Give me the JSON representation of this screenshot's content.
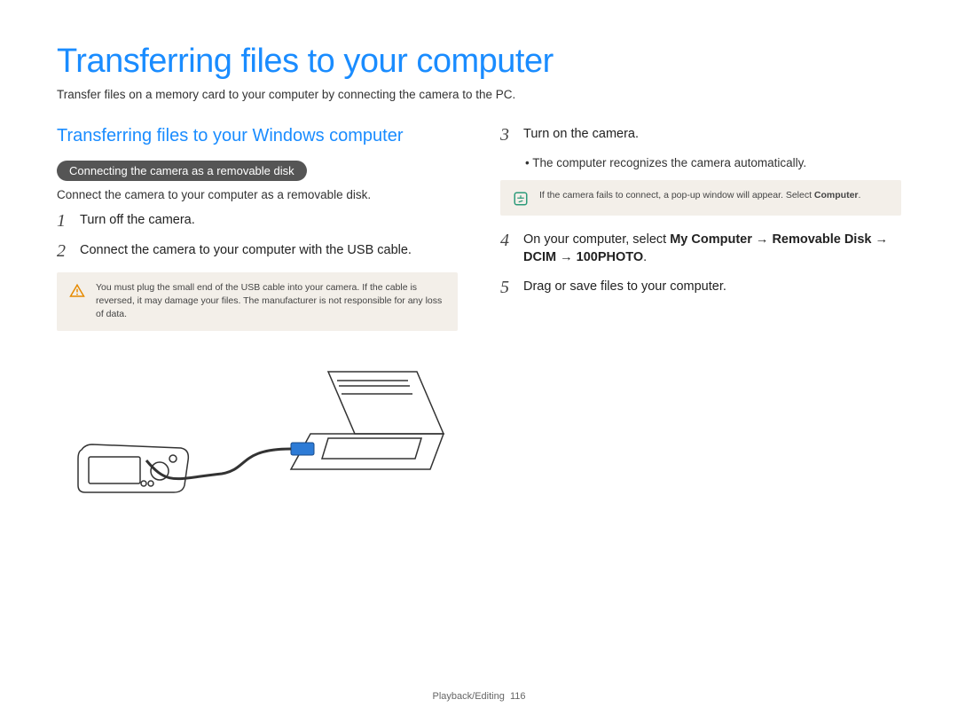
{
  "title": "Transferring files to your computer",
  "intro": "Transfer files on a memory card to your computer by connecting the camera to the PC.",
  "left": {
    "section_title": "Transferring files to your Windows computer",
    "pill": "Connecting the camera as a removable disk",
    "pill_sub": "Connect the camera to your computer as a removable disk.",
    "step1_num": "1",
    "step1_text": "Turn off the camera.",
    "step2_num": "2",
    "step2_text": "Connect the camera to your computer with the USB cable.",
    "warning": "You must plug the small end of the USB cable into your camera. If the cable is reversed, it may damage your files. The manufacturer is not responsible for any loss of data."
  },
  "right": {
    "step3_num": "3",
    "step3_text": "Turn on the camera.",
    "step3_bullet": "The computer recognizes the camera automatically.",
    "note_prefix": "If the camera fails to connect, a pop-up window will appear. Select ",
    "note_bold": "Computer",
    "note_suffix": ".",
    "step4_num": "4",
    "step4_prefix": "On your computer, select ",
    "step4_path1": "My Computer",
    "step4_arrow1": " → ",
    "step4_path2": "Removable Disk",
    "step4_arrow2": " → ",
    "step4_path3": "DCIM",
    "step4_arrow3": " → ",
    "step4_path4": "100PHOTO",
    "step4_period": ".",
    "step5_num": "5",
    "step5_text": "Drag or save files to your computer."
  },
  "footer": {
    "section": "Playback/Editing",
    "page": "116"
  }
}
